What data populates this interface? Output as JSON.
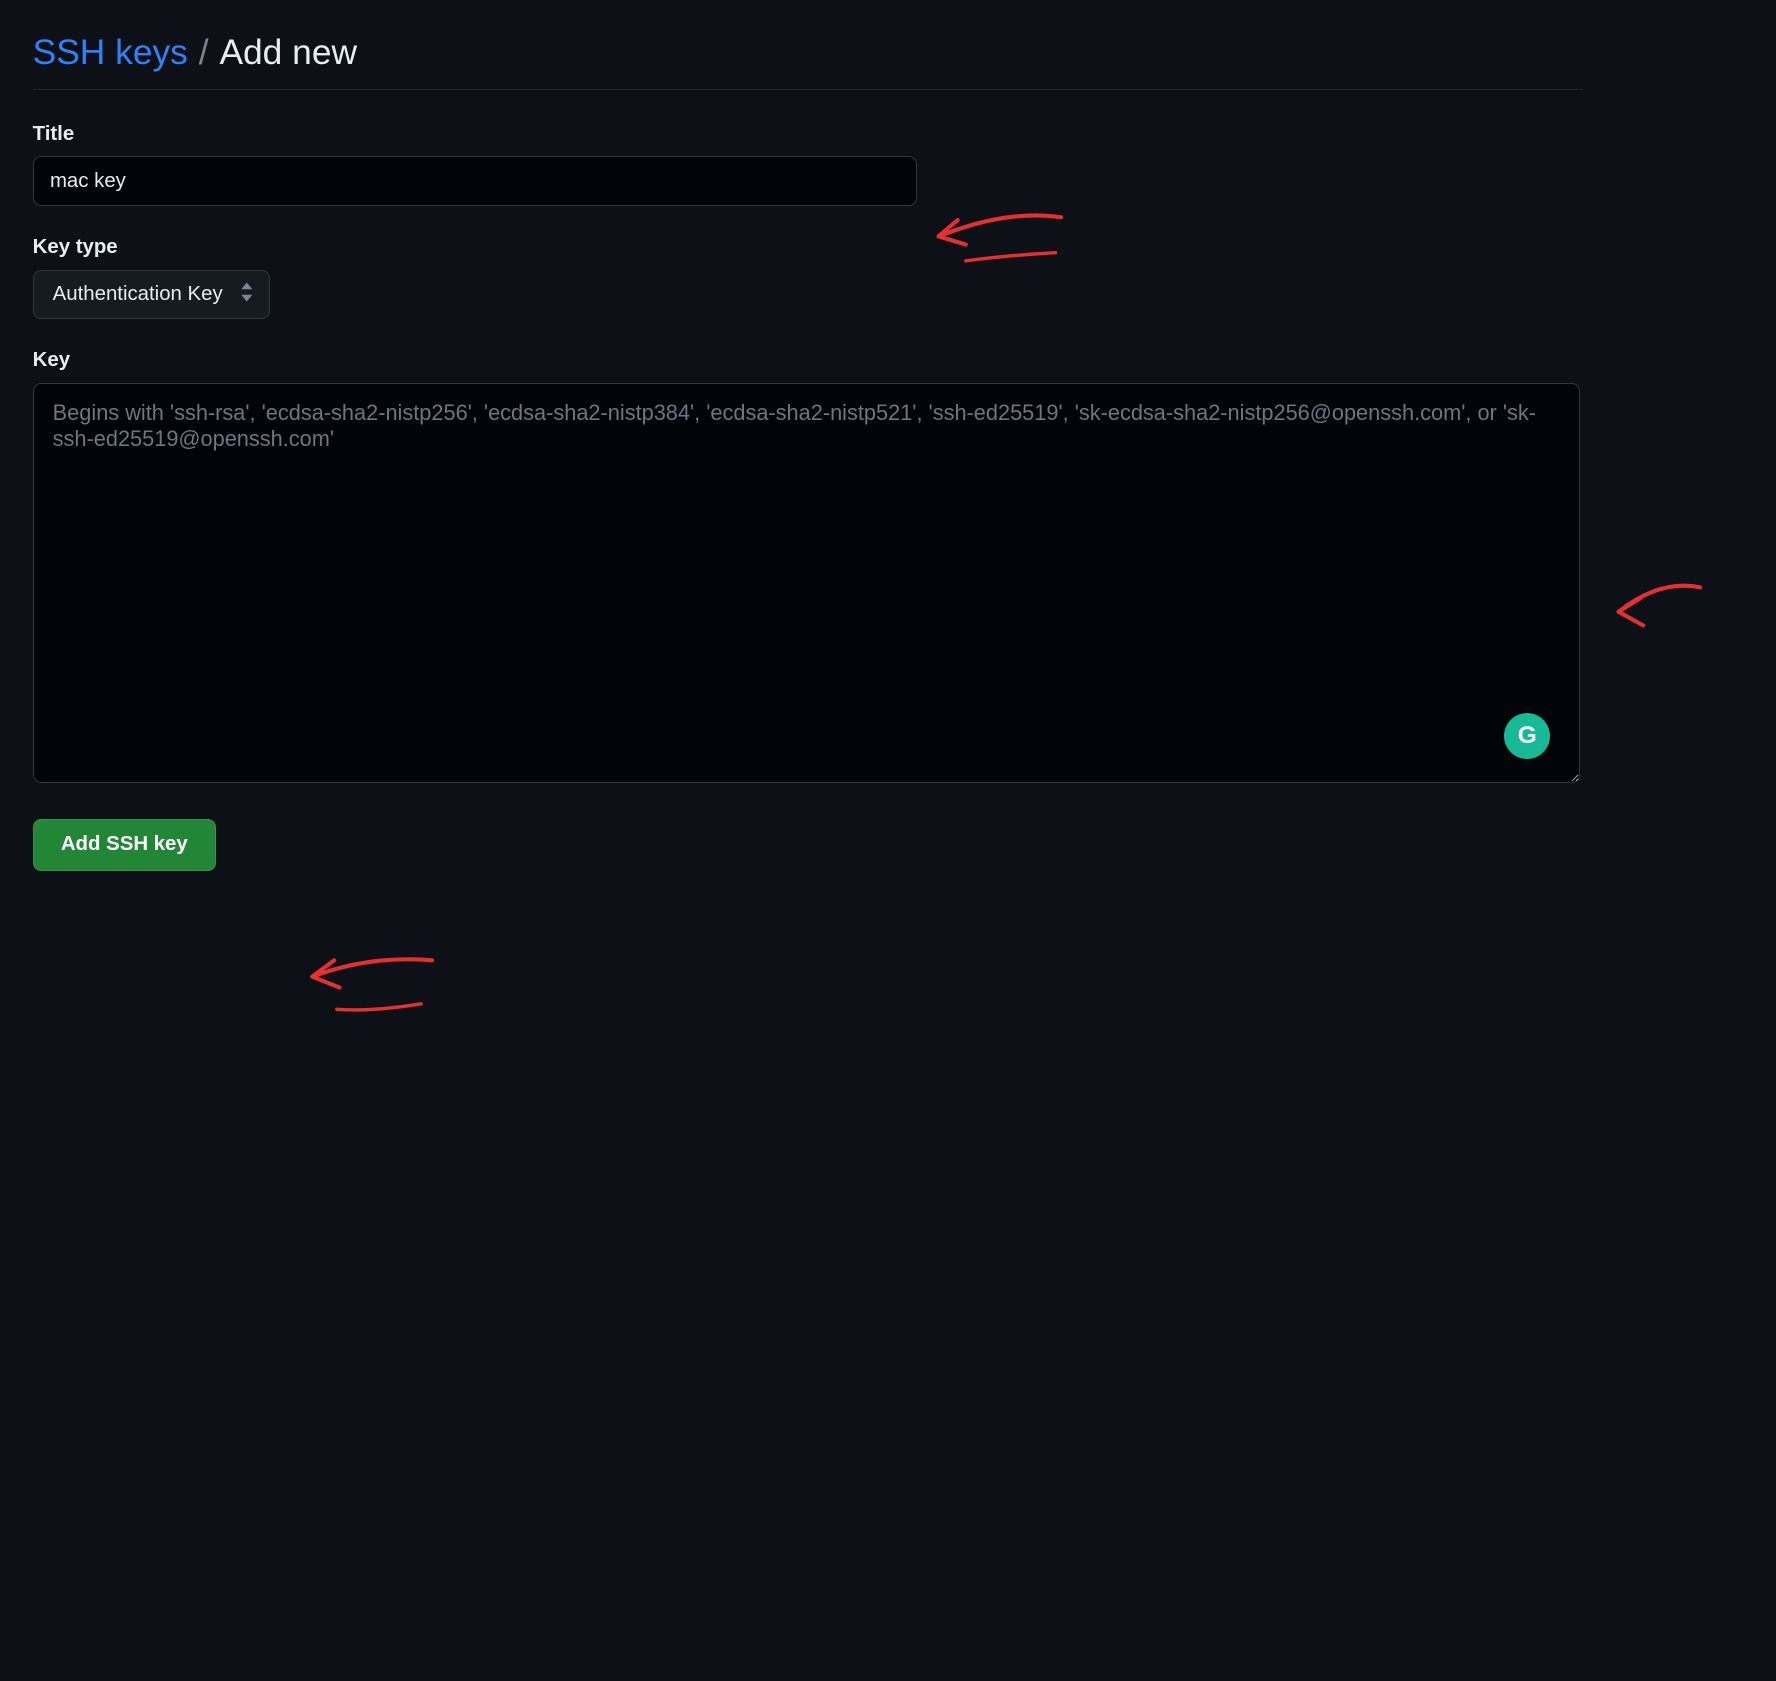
{
  "breadcrumb": {
    "parent": "SSH keys",
    "separator": "/",
    "current": "Add new"
  },
  "form": {
    "title_label": "Title",
    "title_value": "mac key",
    "keytype_label": "Key type",
    "keytype_selected": "Authentication Key",
    "key_label": "Key",
    "key_value": "",
    "key_placeholder": "Begins with 'ssh-rsa', 'ecdsa-sha2-nistp256', 'ecdsa-sha2-nistp384', 'ecdsa-sha2-nistp521', 'ssh-ed25519', 'sk-ecdsa-sha2-nistp256@openssh.com', or 'sk-ssh-ed25519@openssh.com'",
    "submit_label": "Add SSH key"
  },
  "overlay": {
    "grammarly_glyph": "G"
  },
  "annotations": {
    "arrow1_color": "#e63030",
    "arrow2_color": "#e63030",
    "arrow3_color": "#e63030"
  }
}
